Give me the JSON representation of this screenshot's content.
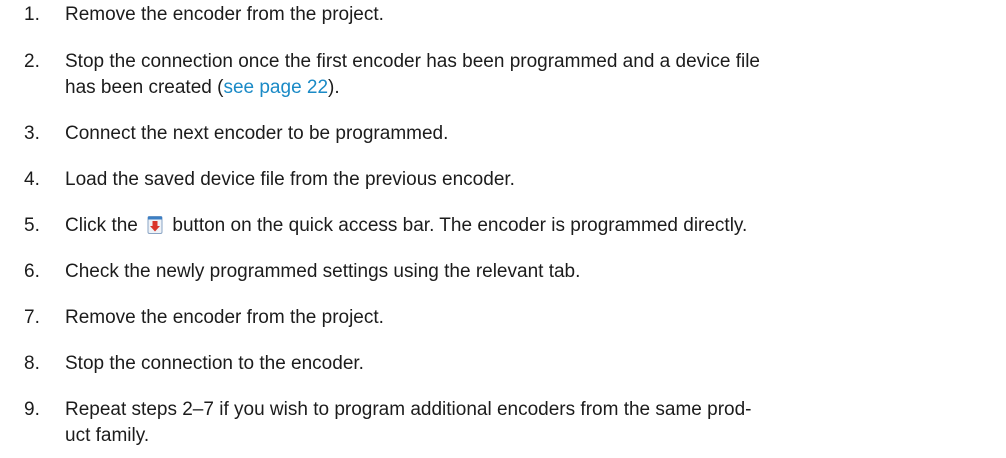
{
  "steps": [
    {
      "number": "1.",
      "text": "Remove the encoder from the project."
    },
    {
      "number": "2.",
      "line1": "Stop the connection once the first encoder has been programmed and a device file",
      "before_link": "has been created (",
      "link": "see page 22",
      "after_link": ")."
    },
    {
      "number": "3.",
      "text": "Connect the next encoder to be programmed."
    },
    {
      "number": "4.",
      "text": "Load the saved device file from the previous encoder."
    },
    {
      "number": "5.",
      "before_icon": "Click the",
      "icon": "write-to-device-icon",
      "after_icon": "button on the quick access bar. The encoder is programmed directly."
    },
    {
      "number": "6.",
      "text": "Check the newly programmed settings using the relevant tab."
    },
    {
      "number": "7.",
      "text": "Remove the encoder from the project."
    },
    {
      "number": "8.",
      "text": "Stop the connection to the encoder."
    },
    {
      "number": "9.",
      "line1": "Repeat steps 2–7 if you wish to program additional encoders from the same prod-",
      "line2": "uct family."
    }
  ],
  "colors": {
    "text": "#1c1c1c",
    "link": "#1a8ac6",
    "icon_red": "#d9342b",
    "icon_blue": "#3c7fc4"
  }
}
